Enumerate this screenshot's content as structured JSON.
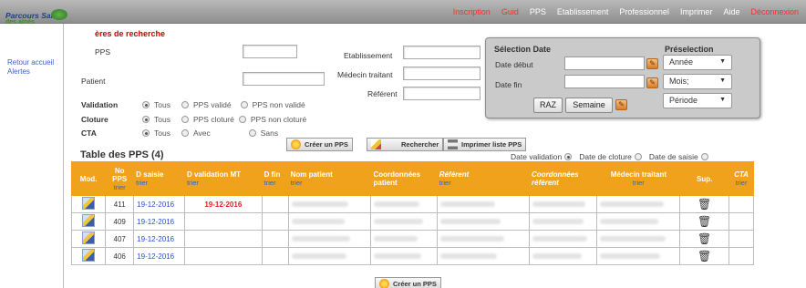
{
  "nav": {
    "items": [
      {
        "label": "Inscription",
        "color": "#ff2a2a"
      },
      {
        "label": "Guid",
        "color": "#ff2a2a"
      },
      {
        "label": "PPS",
        "color": "#ffffff"
      },
      {
        "label": "Etablissement",
        "color": "#ffffff"
      },
      {
        "label": "Professionnel",
        "color": "#ffffff"
      },
      {
        "label": "Imprimer",
        "color": "#ffffff"
      },
      {
        "label": "Aide",
        "color": "#ffffff"
      },
      {
        "label": "Déconnexion",
        "color": "#ff2a2a"
      }
    ]
  },
  "logo": {
    "line1": "Parcours Santé",
    "line2": "des aînés"
  },
  "sidebar": {
    "items": [
      "Retour accueil",
      "Alertes"
    ]
  },
  "criteria": {
    "title": "ères de recherche",
    "pps_label": "PPS",
    "patient_label": "Patient",
    "etablissement_label": "Etablissement",
    "medecin_label": "Médecin traitant",
    "referent_label": "Référent",
    "validation": {
      "label": "Validation",
      "options": [
        "Tous",
        "PPS validé",
        "PPS non validé"
      ],
      "selected": 0
    },
    "cloture": {
      "label": "Cloture",
      "options": [
        "Tous",
        "PPS cloturé",
        "PPS non cloturé"
      ],
      "selected": 0
    },
    "cta": {
      "label": "CTA",
      "options": [
        "Tous",
        "Avec",
        "Sans"
      ],
      "selected": 0
    }
  },
  "selection": {
    "title": "Sélection Date",
    "preselection_title": "Préselection",
    "date_debut_label": "Date début",
    "date_fin_label": "Date fin",
    "year_select": "Année",
    "month_select": "Mois;",
    "period_select": "Période",
    "raz_label": "RAZ",
    "semaine_label": "Semaine"
  },
  "actions": {
    "create_label": "Créer un PPS",
    "search_label": "Rechercher",
    "print_label": "Imprimer liste PPS"
  },
  "date_filter": {
    "options": [
      "Date validation",
      "Date de cloture",
      "Date de saisie"
    ],
    "selected": 0
  },
  "table": {
    "title": "Table des PPS (4)",
    "sort_label": "trier",
    "columns": {
      "mod": "Mod.",
      "no_pps": "No PPS",
      "d_saisie": "D saisie",
      "d_validation": "D validation MT",
      "d_fin": "D fin",
      "nom_patient": "Nom patient",
      "coord_patient": "Coordonnées patient",
      "referent": "Référent",
      "coord_referent": "Coordonnées référent",
      "medecin": "Médecin traitant",
      "sup": "Sup.",
      "cta": "CTA"
    },
    "rows": [
      {
        "no": "411",
        "saisie": "19-12-2016",
        "validation": "19-12-2016"
      },
      {
        "no": "409",
        "saisie": "19-12-2016",
        "validation": ""
      },
      {
        "no": "407",
        "saisie": "19-12-2016",
        "validation": ""
      },
      {
        "no": "406",
        "saisie": "19-12-2016",
        "validation": ""
      }
    ]
  },
  "bottom": {
    "create_label": "Créer un PPS"
  }
}
